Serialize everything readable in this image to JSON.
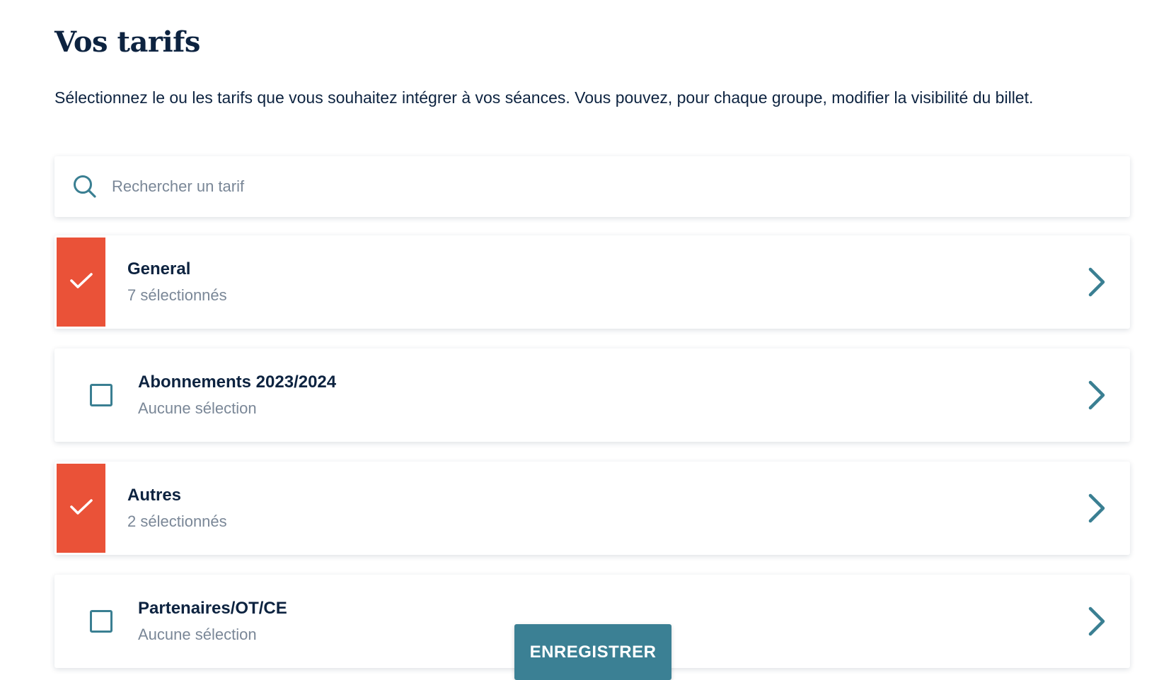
{
  "page": {
    "title": "Vos tarifs",
    "intro": "Sélectionnez le ou les tarifs que vous souhaitez intégrer à vos séances. Vous pouvez, pour chaque groupe, modifier la visibilité du billet."
  },
  "search": {
    "placeholder": "Rechercher un tarif",
    "value": "",
    "icon": "search-icon"
  },
  "groups": [
    {
      "name": "General",
      "status": "7 sélectionnés",
      "checked": true
    },
    {
      "name": "Abonnements 2023/2024",
      "status": "Aucune sélection",
      "checked": false
    },
    {
      "name": "Autres",
      "status": "2 sélectionnés",
      "checked": true
    },
    {
      "name": "Partenaires/OT/CE",
      "status": "Aucune sélection",
      "checked": false
    }
  ],
  "actions": {
    "save_label": "ENREGISTRER"
  },
  "colors": {
    "title_text": "#0d2340",
    "muted_text": "#7a8797",
    "accent_checked": "#ea5238",
    "accent_teal": "#3a7f92",
    "save_button": "#3b8094"
  },
  "icons": {
    "checked": "check-icon",
    "unchecked": "empty-checkbox-icon",
    "row_action": "chevron-right-icon"
  }
}
